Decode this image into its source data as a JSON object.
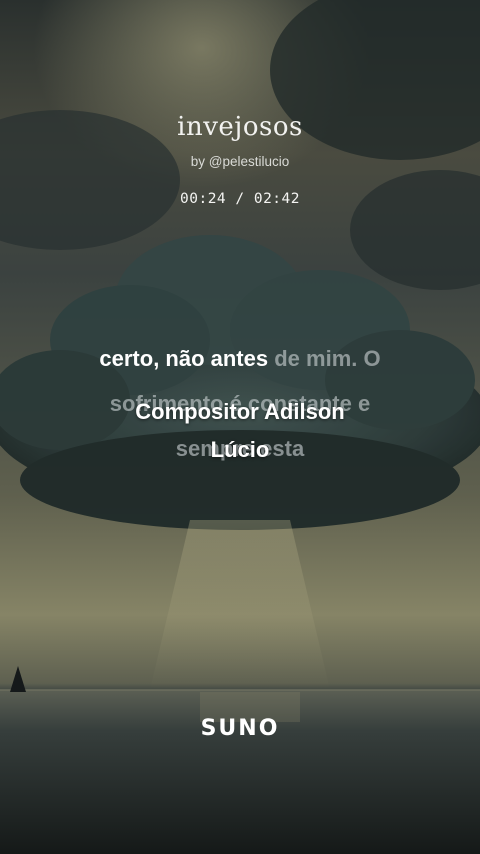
{
  "song": {
    "title": "invejosos",
    "byline": "by @pelestilucio",
    "time_display": "00:24 / 02:42",
    "elapsed_seconds": 24,
    "duration_seconds": 162
  },
  "lyrics": {
    "line1_sung": "certo, não antes ",
    "line1_unsung": "de mim. O",
    "line2": "sofrimento é constante e",
    "line3": "sempre esta"
  },
  "caption": {
    "line1": "Compositor Adilson",
    "line2": "Lúcio"
  },
  "brand": {
    "logo": "SUNO"
  },
  "colors": {
    "sung_text": "#ffffff",
    "unsung_text": "#c8ced0",
    "sky_dark": "#1e2624",
    "sky_light": "#8f8d6e",
    "sea": "#303836"
  }
}
